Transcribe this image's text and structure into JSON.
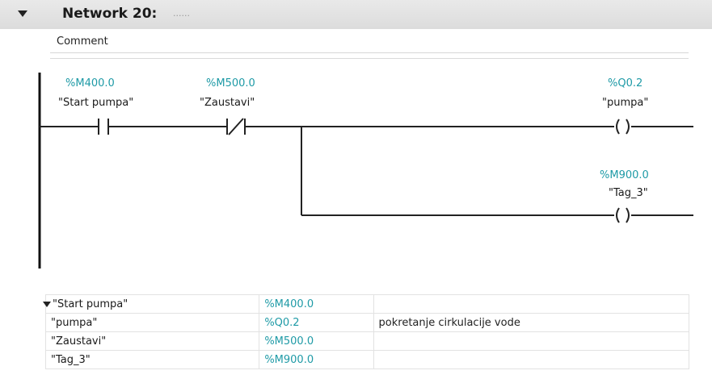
{
  "network": {
    "title": "Network 20:",
    "title_suffix": "......",
    "comment": "Comment"
  },
  "rungs": {
    "contact_no": {
      "address": "%M400.0",
      "tag": "\"Start pumpa\""
    },
    "contact_nc": {
      "address": "%M500.0",
      "tag": "\"Zaustavi\""
    },
    "coil_1": {
      "address": "%Q0.2",
      "tag": "\"pumpa\""
    },
    "coil_2": {
      "address": "%M900.0",
      "tag": "\"Tag_3\""
    }
  },
  "tag_table": [
    {
      "name": "\"Start pumpa\"",
      "address": "%M400.0",
      "comment": ""
    },
    {
      "name": "\"pumpa\"",
      "address": "%Q0.2",
      "comment": "pokretanje cirkulacije vode"
    },
    {
      "name": "\"Zaustavi\"",
      "address": "%M500.0",
      "comment": ""
    },
    {
      "name": "\"Tag_3\"",
      "address": "%M900.0",
      "comment": ""
    }
  ],
  "colors": {
    "address": "#1e9aa6",
    "header_bg": "#dcdcdc"
  },
  "icons": {
    "collapse": "triangle-down-icon"
  }
}
